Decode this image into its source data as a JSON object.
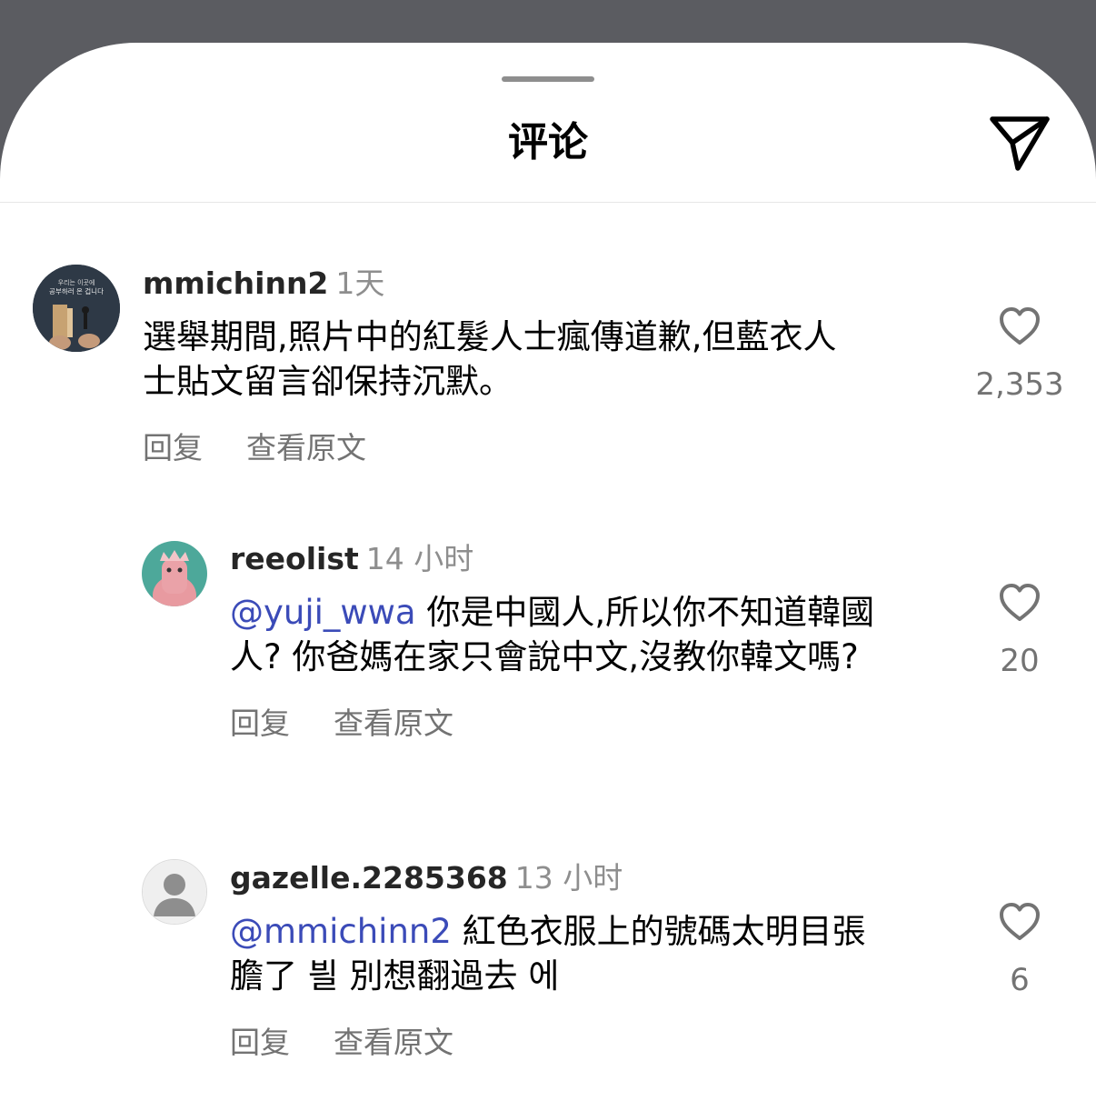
{
  "header": {
    "title": "评论"
  },
  "comments": [
    {
      "username": "mmichinn2",
      "time": "1天",
      "mention": "",
      "text_line1": "選舉期間,照片中的紅髮人士瘋傳道歉,但藍衣人",
      "text_line2": "士貼文留言卻保持沉默。",
      "reply_label": "回复",
      "translate_label": "查看原文",
      "like_count": "2,353"
    },
    {
      "username": "reeolist",
      "time": "14 小时",
      "mention": "@yuji_wwa",
      "text_line1": "你是中國人,所以你不知道韓國",
      "text_line2": "人? 你爸媽在家只會說中文,沒教你韓文嗎?",
      "reply_label": "回复",
      "translate_label": "查看原文",
      "like_count": "20"
    },
    {
      "username": "gazelle.2285368",
      "time": "13 小时",
      "mention": "@mmichinn2",
      "text_line1": "紅色衣服上的號碼太明目張",
      "text_line2": "膽了 븰 別想翻過去 에",
      "reply_label": "回复",
      "translate_label": "查看原文",
      "like_count": "6"
    }
  ],
  "avatar_texts": {
    "line1": "우리는 이곳에",
    "line2": "공부하러 온 겁니다"
  },
  "icons": {
    "share": "paper-plane-icon",
    "like": "heart-outline-icon",
    "default_avatar": "person-placeholder-icon"
  },
  "colors": {
    "mention": "#3b4bb8",
    "secondary_text": "#737373",
    "sheet_background": "#ffffff",
    "backdrop": "#5b5c61"
  }
}
